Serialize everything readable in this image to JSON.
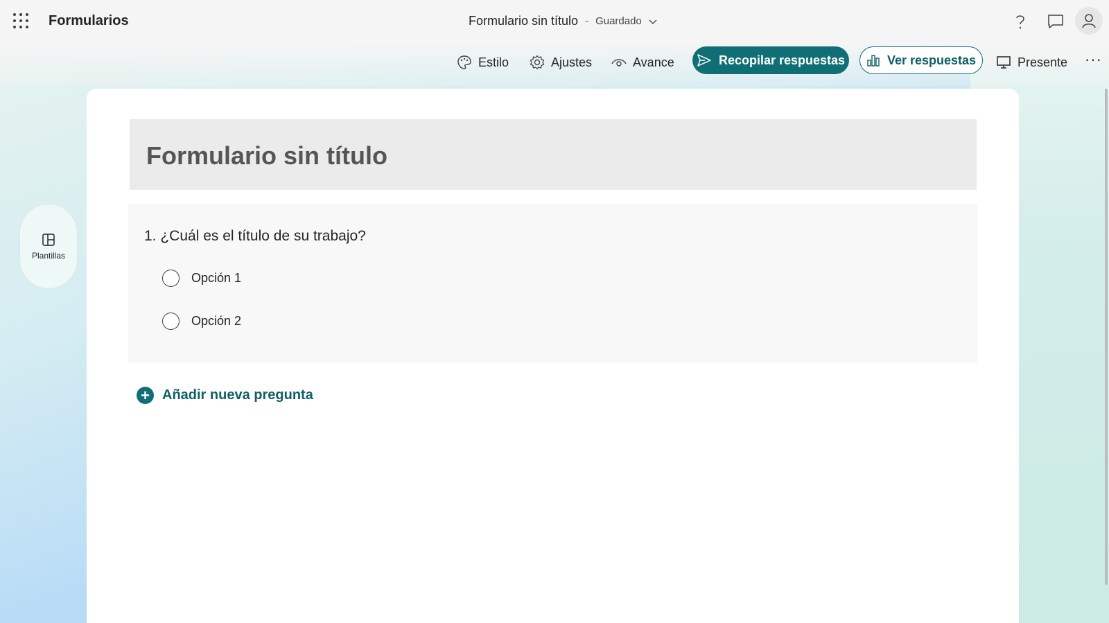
{
  "app": {
    "name": "Formularios"
  },
  "header": {
    "doc_title": "Formulario sin título",
    "separator": "-",
    "status": "Guardado"
  },
  "toolbar": {
    "style_label": "Estilo",
    "settings_label": "Ajustes",
    "preview_label": "Avance",
    "collect_label": "Recopilar respuestas",
    "view_responses_label": "Ver respuestas",
    "present_label": "Presente",
    "more_label": "···"
  },
  "side": {
    "templates_label": "Plantillas"
  },
  "form": {
    "title": "Formulario sin título",
    "questions": [
      {
        "text": "1. ¿Cuál es el título de su trabajo?",
        "options": [
          "Opción 1",
          "Opción 2"
        ]
      }
    ],
    "add_question_label": "Añadir nueva pregunta"
  },
  "colors": {
    "accent": "#0f6f75",
    "title_block": "#ebebeb",
    "question_block": "#f8f8f8"
  }
}
